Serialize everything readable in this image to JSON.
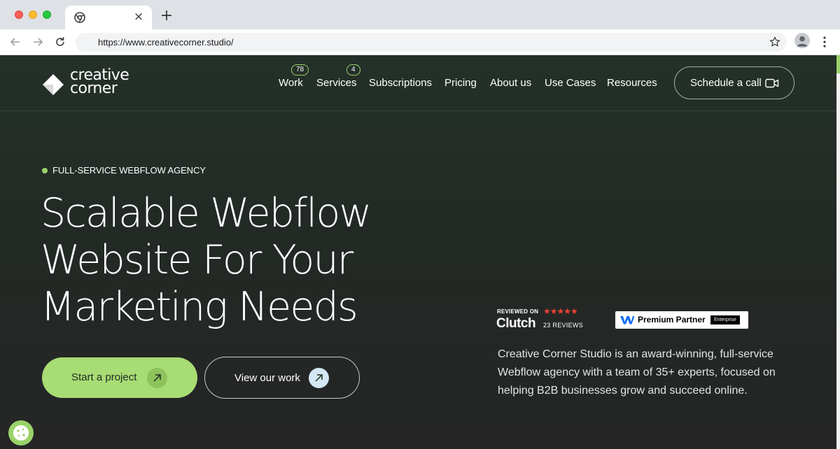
{
  "browser": {
    "tab_close": "×",
    "new_tab": "+",
    "url": "https://www.creativecorner.studio/"
  },
  "header": {
    "logo_line1": "creative",
    "logo_line2": "corner",
    "nav": [
      {
        "label": "Work",
        "badge": "78"
      },
      {
        "label": "Services",
        "badge": "4"
      },
      {
        "label": "Subscriptions"
      },
      {
        "label": "Pricing"
      },
      {
        "label": "About us"
      },
      {
        "label": "Use Cases"
      },
      {
        "label": "Resources"
      }
    ],
    "cta_label": "Schedule a call"
  },
  "hero": {
    "eyebrow": "FULL-SERVICE WEBFLOW AGENCY",
    "title_lines": [
      "Scalable Webflow",
      "Website For Your",
      "Marketing Needs"
    ],
    "primary_button": "Start a project",
    "secondary_button": "View our work"
  },
  "badges": {
    "clutch_reviewed": "REVIEWED ON",
    "clutch_stars": "★★★★★",
    "clutch_name": "Clutch",
    "clutch_reviews": "23 REVIEWS",
    "partner_label": "Premium Partner",
    "partner_tier": "Enterprise"
  },
  "about": "Creative Corner Studio is an award-winning, full-service Webflow agency with a team of 35+ experts, focused on helping B2B businesses grow and succeed online.",
  "colors": {
    "accent_green": "#a8dc74",
    "background_dark": "#232925",
    "star_red": "#ef4335"
  }
}
